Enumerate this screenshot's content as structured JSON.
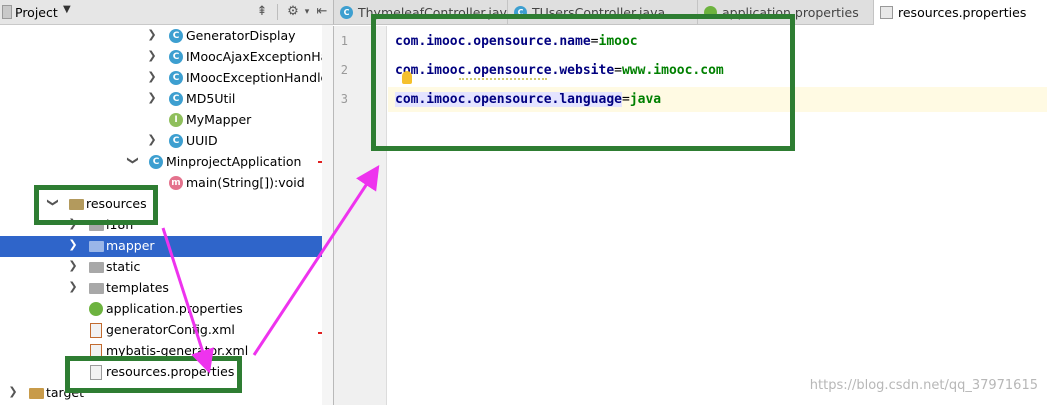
{
  "project_panel": {
    "title": "Project",
    "tree": [
      {
        "label": "GeneratorDisplay",
        "icon": "class",
        "expandable": true
      },
      {
        "label": "IMoocAjaxExceptionHandler",
        "icon": "class",
        "expandable": true
      },
      {
        "label": "IMoocExceptionHandler",
        "icon": "class",
        "expandable": true
      },
      {
        "label": "MD5Util",
        "icon": "class",
        "expandable": true
      },
      {
        "label": "MyMapper",
        "icon": "interface",
        "expandable": false
      },
      {
        "label": "UUID",
        "icon": "class",
        "expandable": true
      },
      {
        "label": "MinprojectApplication",
        "icon": "spring-class",
        "expandable": true,
        "expanded": true
      },
      {
        "label": "main(String[]):void",
        "icon": "method",
        "expandable": false
      },
      {
        "label": "resources",
        "icon": "resources-folder",
        "expandable": true,
        "expanded": true
      },
      {
        "label": "i18n",
        "icon": "folder",
        "expandable": true
      },
      {
        "label": "mapper",
        "icon": "folder",
        "expandable": true,
        "selected": true
      },
      {
        "label": "static",
        "icon": "folder",
        "expandable": true
      },
      {
        "label": "templates",
        "icon": "folder",
        "expandable": true
      },
      {
        "label": "application.properties",
        "icon": "spring-properties",
        "expandable": false
      },
      {
        "label": "generatorConfig.xml",
        "icon": "xml-file",
        "expandable": false
      },
      {
        "label": "mybatis-generator.xml",
        "icon": "xml-file",
        "expandable": false
      },
      {
        "label": "resources.properties",
        "icon": "properties-file",
        "expandable": false
      },
      {
        "label": "target",
        "icon": "target-folder",
        "expandable": true
      }
    ]
  },
  "tabs": [
    {
      "label": "ThymeleafController.java",
      "icon": "class-icon",
      "active": false
    },
    {
      "label": "TUsersController.java",
      "icon": "class-icon",
      "active": false
    },
    {
      "label": "application.properties",
      "icon": "spring-icon",
      "active": false
    },
    {
      "label": "resources.properties",
      "icon": "properties-icon",
      "active": true
    }
  ],
  "editor": {
    "line_numbers": [
      "1",
      "2",
      "3"
    ],
    "lines": [
      {
        "key": "com.imooc.opensource.name",
        "eq": "=",
        "value": "imooc"
      },
      {
        "key": "com.imooc.opensource.website",
        "eq": "=",
        "value": "www.imooc.com"
      },
      {
        "key": "com.imooc.opensource.language",
        "eq": "=",
        "value": "java"
      }
    ]
  },
  "watermark": "https://blog.csdn.net/qq_37971615",
  "colors": {
    "annotation_box": "#2e7d32",
    "annotation_arrow": "#ee33ee",
    "selection": "#2f65ca",
    "key": "#000080",
    "value": "#008000"
  }
}
